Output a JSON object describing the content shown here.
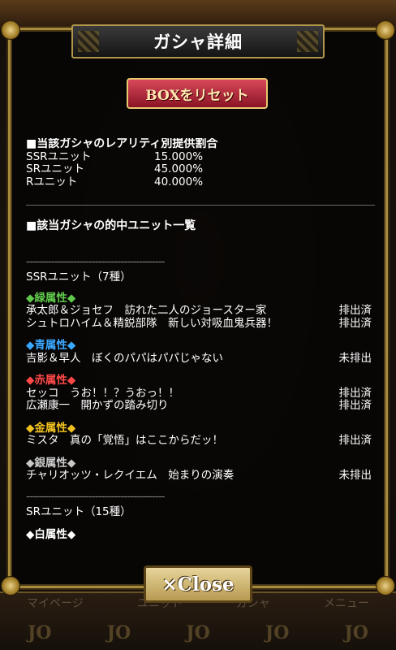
{
  "modal": {
    "title": "ガシャ詳細",
    "reset_button": "BOXをリセット",
    "close_button": "×Close"
  },
  "rates": {
    "heading": "■当該ガシャのレアリティ別提供割合",
    "rows": [
      {
        "name": "SSRユニット",
        "value": "15.000%"
      },
      {
        "name": "SRユニット",
        "value": "45.000%"
      },
      {
        "name": "Rユニット",
        "value": "40.000%"
      }
    ]
  },
  "units": {
    "heading": "■該当ガシャの的中ユニット一覧",
    "separator": "--------------------------------------------",
    "ssr_label": "SSRユニット（7種）",
    "sr_label": "SRユニット（15種）",
    "groups": [
      {
        "attr": "◆緑属性◆",
        "color": "#5fc94a",
        "items": [
          {
            "name": "承太郎＆ジョセフ　訪れた二人のジョースター家",
            "status": "排出済"
          },
          {
            "name": "シュトロハイム＆精鋭部隊　新しい対吸血鬼兵器！",
            "status": "排出済"
          }
        ]
      },
      {
        "attr": "◆青属性◆",
        "color": "#3aa8ff",
        "items": [
          {
            "name": "吉影＆早人　ぼくのパパはパパじゃない",
            "status": "未排出"
          }
        ]
      },
      {
        "attr": "◆赤属性◆",
        "color": "#ff4848",
        "items": [
          {
            "name": "セッコ　うお！！？うおっ！！",
            "status": "排出済"
          },
          {
            "name": "広瀬康一　開かずの踏み切り",
            "status": "排出済"
          }
        ]
      },
      {
        "attr": "◆金属性◆",
        "color": "#f0c020",
        "items": [
          {
            "name": "ミスタ　真の「覚悟」はここからだッ！",
            "status": "排出済"
          }
        ]
      },
      {
        "attr": "◆銀属性◆",
        "color": "#c8c8c8",
        "items": [
          {
            "name": "チャリオッツ・レクイエム　始まりの演奏",
            "status": "未排出"
          }
        ]
      }
    ],
    "sr_first_attr": "◆白属性◆",
    "sr_first_attr_color": "#ffffff"
  },
  "background": {
    "nav": [
      "マイページ",
      "ユニット",
      "ガシャ",
      "メニュー"
    ],
    "jo": [
      "JO",
      "JO",
      "JO",
      "JO",
      "JO"
    ]
  }
}
